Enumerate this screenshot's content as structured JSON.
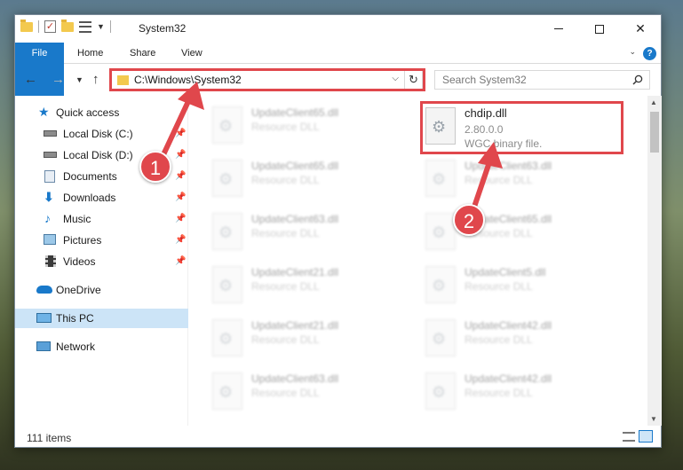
{
  "window": {
    "title": "System32",
    "status_count": "111 items"
  },
  "ribbon": {
    "tabs": [
      {
        "label": "File"
      },
      {
        "label": "Home"
      },
      {
        "label": "Share"
      },
      {
        "label": "View"
      }
    ],
    "help_label": "?"
  },
  "address": {
    "path": "C:\\Windows\\System32",
    "search_placeholder": "Search System32"
  },
  "sidebar": {
    "items": [
      {
        "label": "Quick access",
        "icon": "star-icon"
      },
      {
        "label": "Local Disk (C:)",
        "icon": "drive-icon",
        "pinned": true
      },
      {
        "label": "Local Disk (D:)",
        "icon": "drive-icon",
        "pinned": true
      },
      {
        "label": "Documents",
        "icon": "documents-icon",
        "pinned": true
      },
      {
        "label": "Downloads",
        "icon": "downloads-icon",
        "pinned": true
      },
      {
        "label": "Music",
        "icon": "music-icon",
        "pinned": true
      },
      {
        "label": "Pictures",
        "icon": "pictures-icon",
        "pinned": true
      },
      {
        "label": "Videos",
        "icon": "videos-icon",
        "pinned": true
      },
      {
        "label": "OneDrive",
        "icon": "onedrive-icon"
      },
      {
        "label": "This PC",
        "icon": "computer-icon",
        "selected": true
      },
      {
        "label": "Network",
        "icon": "network-icon"
      }
    ]
  },
  "files": {
    "left_column": [
      {
        "name": "UpdateClient65.dll",
        "type": "Resource DLL"
      },
      {
        "name": "UpdateClient65.dll",
        "type": "Resource DLL"
      },
      {
        "name": "UpdateClient63.dll",
        "type": "Resource DLL"
      },
      {
        "name": "UpdateClient21.dll",
        "type": "Resource DLL"
      },
      {
        "name": "UpdateClient21.dll",
        "type": "Resource DLL"
      },
      {
        "name": "UpdateClient63.dll",
        "type": "Resource DLL"
      }
    ],
    "highlighted": {
      "name": "chdip.dll",
      "version": "2.80.0.0",
      "type": "WGC binary file."
    },
    "right_column": [
      {
        "name": "UpdateClient63.dll",
        "type": "Resource DLL"
      },
      {
        "name": "UpdateClient65.dll",
        "type": "Resource DLL"
      },
      {
        "name": "UpdateClient5.dll",
        "type": "Resource DLL"
      },
      {
        "name": "UpdateClient42.dll",
        "type": "Resource DLL"
      },
      {
        "name": "UpdateClient42.dll",
        "type": "Resource DLL"
      }
    ]
  },
  "annotations": {
    "step1": "1",
    "step2": "2",
    "color": "#e0474c"
  }
}
